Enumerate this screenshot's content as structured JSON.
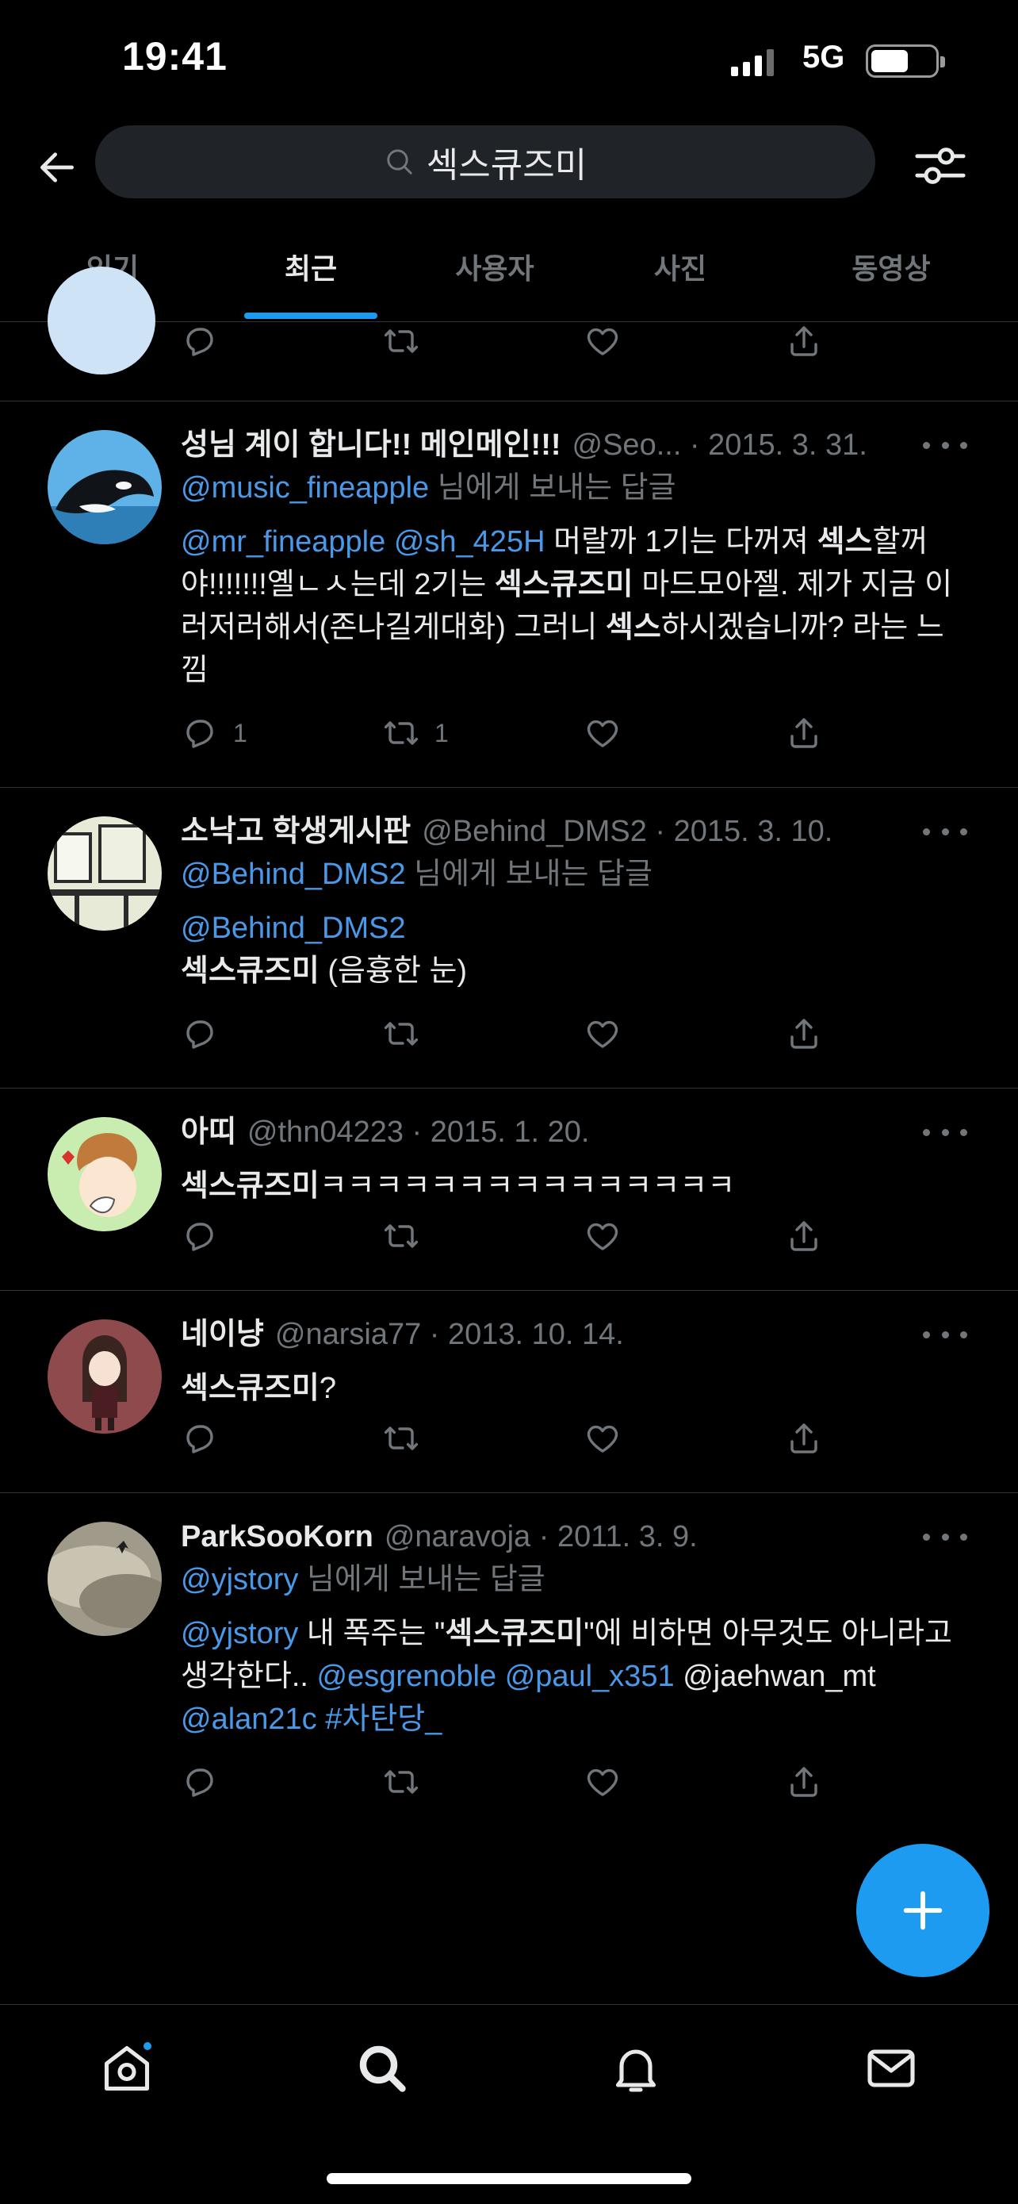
{
  "status": {
    "time": "19:41",
    "network": "5G"
  },
  "search": {
    "query": "섹스큐즈미"
  },
  "tabs": [
    "인기",
    "최근",
    "사용자",
    "사진",
    "동영상"
  ],
  "active_tab": "최근",
  "reply_suffix": "님에게 보내는 답글",
  "tweets": [
    {
      "name": "성님 계이 합니다!! 메인메인!!!",
      "handle_date": "@Seo... · 2015. 3. 31.",
      "reply_to": "@music_fineapple",
      "body": [
        "@mr_fineapple",
        " ",
        "@sh_425H",
        " 머랄까 1기는 다꺼져 ",
        "섹스",
        "할꺼야!!!!!!!옐ㄴㅅ는데 2기는 ",
        "섹스큐즈미",
        " 마드모아젤. 제가 지금 이러저러해서(존나길게대화) 그러니 ",
        "섹스",
        "하시겠습니까? 라는 느낌"
      ],
      "replies": "1",
      "retweets": "1",
      "likes": ""
    },
    {
      "name": "소낙고 학생게시판",
      "handle_date": "@Behind_DMS2 · 2015. 3. 10.",
      "reply_to": "@Behind_DMS2",
      "body": [
        "@Behind_DMS2",
        "섹스큐즈미",
        " (음흉한 눈)"
      ],
      "replies": "",
      "retweets": "",
      "likes": ""
    },
    {
      "name": "아띠",
      "handle_date": "@thn04223 · 2015. 1. 20.",
      "body": [
        "섹스큐즈미",
        "ㅋㅋㅋㅋㅋㅋㅋㅋㅋㅋㅋㅋㅋㅋㅋ"
      ]
    },
    {
      "name": "네이냥",
      "handle_date": "@narsia77 · 2013. 10. 14.",
      "body": [
        "섹스큐즈미",
        "?"
      ]
    },
    {
      "name": "ParkSooKorn",
      "handle_date": "@naravoja · 2011. 3. 9.",
      "reply_to": "@yjstory",
      "body": [
        "@yjstory",
        " 내 폭주는 \"",
        "섹스큐즈미",
        "\"에 비하면 아무것도 아니라고 생각한다..  ",
        "@esgrenoble",
        " ",
        "@paul_x351",
        " @jaehwan_mt ",
        "@alan21c",
        " ",
        "#차탄당_"
      ]
    }
  ],
  "icons": {
    "back": "arrow-left-icon",
    "search": "search-icon",
    "filter": "filter-sliders-icon",
    "reply": "reply-icon",
    "retweet": "retweet-icon",
    "like": "heart-icon",
    "share": "share-icon",
    "compose": "plus-icon",
    "home": "home-icon",
    "explore": "search-icon",
    "notifications": "bell-icon",
    "messages": "mail-icon"
  },
  "colors": {
    "accent": "#1d9bf0",
    "link": "#4a99e9",
    "muted": "#71767b",
    "text": "#e7e9ea",
    "background": "#000000"
  }
}
